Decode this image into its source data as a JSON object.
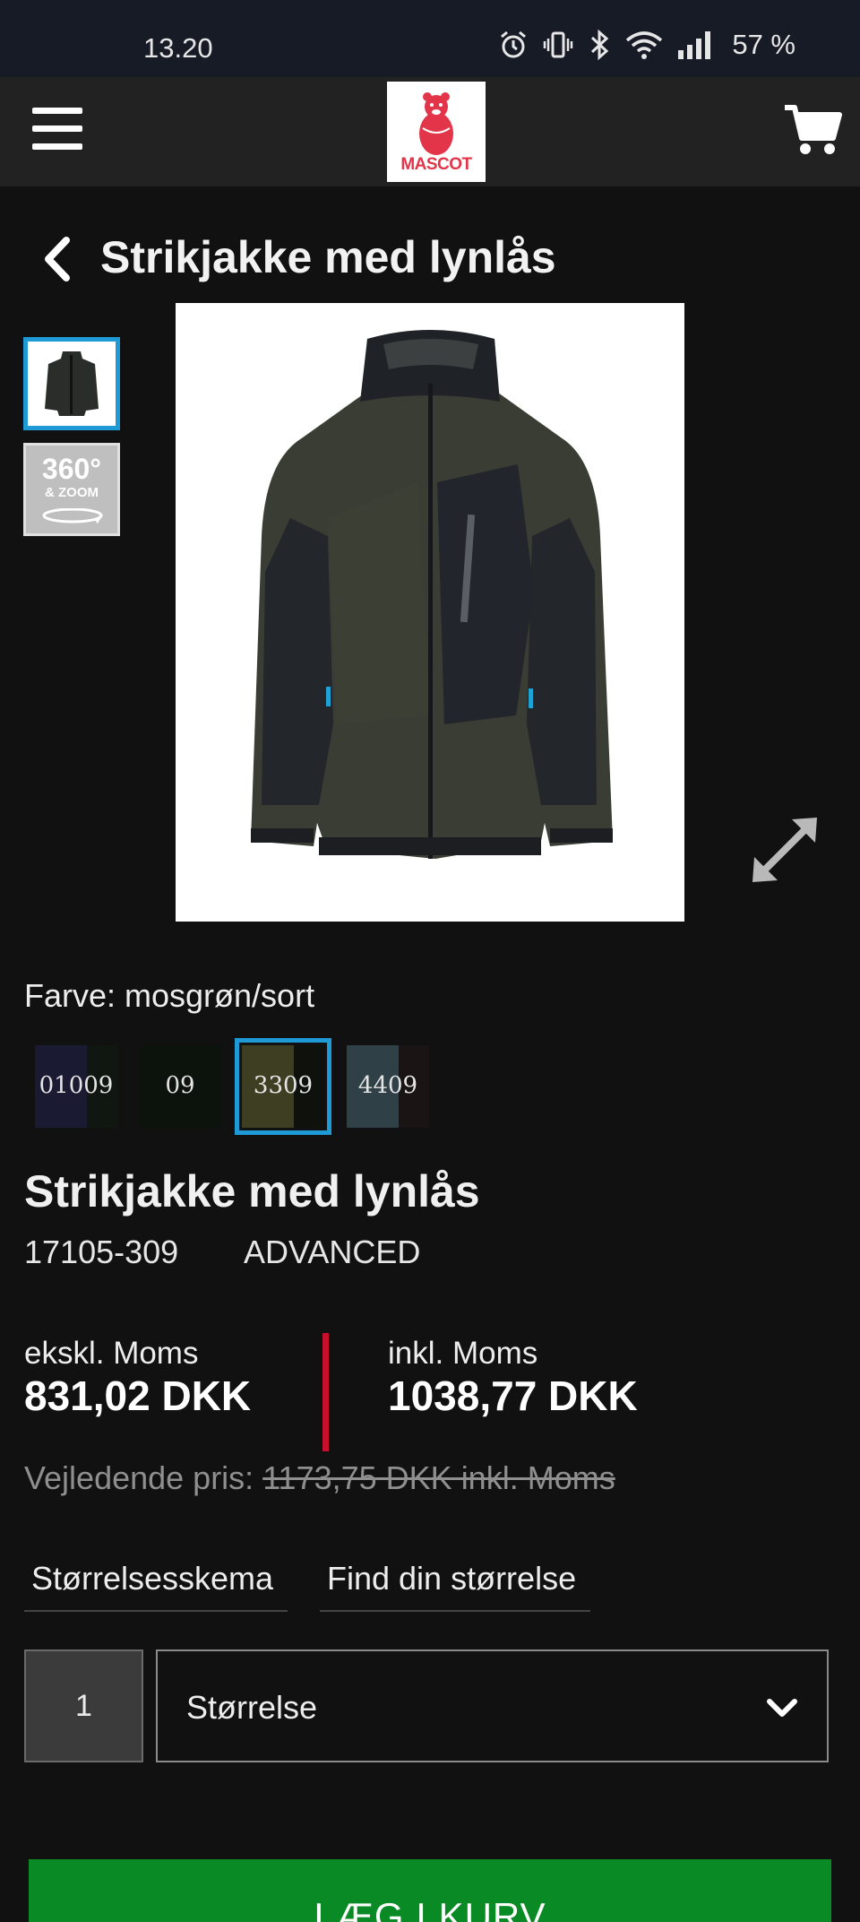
{
  "status_bar": {
    "time": "13.20",
    "battery": "57 %",
    "icons": [
      "alarm-icon",
      "vibrate-icon",
      "bluetooth-icon",
      "wifi-icon",
      "signal-icon"
    ]
  },
  "header": {
    "logo_text": "MASCOT",
    "menu_icon": "hamburger-icon",
    "cart_icon": "cart-icon"
  },
  "page": {
    "title": "Strikjakke med lynlås"
  },
  "gallery": {
    "thumb_360_big": "360°",
    "thumb_360_small": "& ZOOM",
    "expand_icon": "expand-icon"
  },
  "color": {
    "label": "Farve: mosgrøn/sort",
    "swatches": [
      {
        "code": "01009",
        "left_color": "#1a1a33",
        "right_color": "#0f1710"
      },
      {
        "code": "09",
        "left_color": "#0c130c",
        "right_color": "#0c130c"
      },
      {
        "code": "3309",
        "left_color": "#3e3f22",
        "right_color": "#0f120c",
        "selected": true
      },
      {
        "code": "4409",
        "left_color": "#2f4047",
        "right_color": "#1a1414"
      }
    ]
  },
  "product": {
    "name": "Strikjakke med lynlås",
    "sku": "17105-309",
    "line": "ADVANCED"
  },
  "prices": {
    "excl_label": "ekskl. Moms",
    "excl_value": "831,02 DKK",
    "incl_label": "inkl. Moms",
    "incl_value": "1038,77 DKK",
    "rrp_label": "Vejledende pris:",
    "rrp_value": "1173,75 DKK inkl. Moms",
    "divider_color": "#c8102e"
  },
  "size": {
    "chart_link": "Størrelsesskema",
    "find_link": "Find din størrelse",
    "quantity": "1",
    "select_placeholder": "Størrelse"
  },
  "cta": {
    "add_to_cart": "LÆG I KURV",
    "color": "#0a8a24"
  }
}
